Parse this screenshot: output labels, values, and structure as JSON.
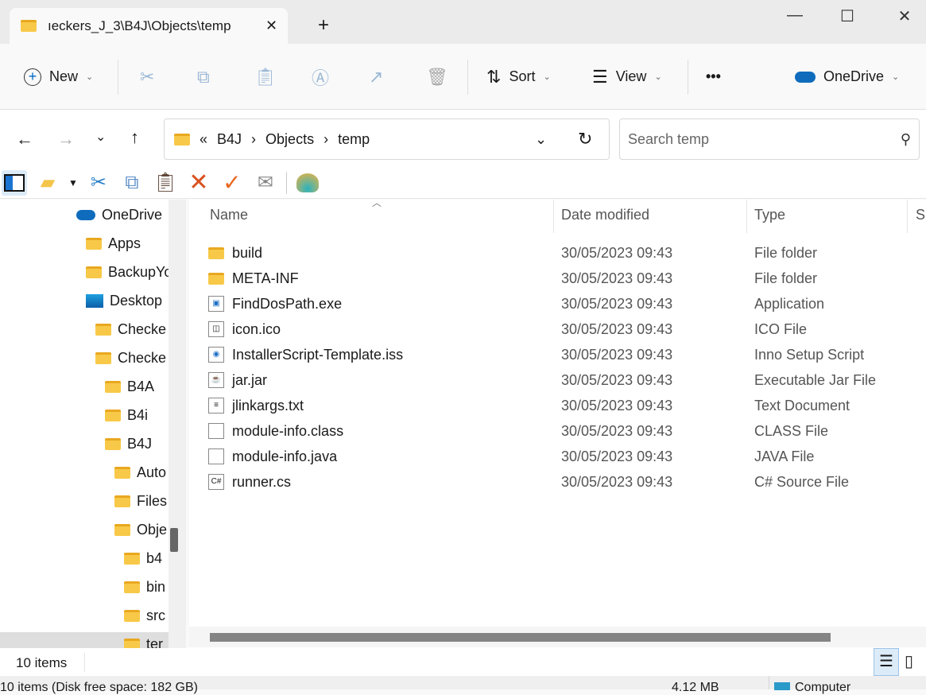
{
  "tab": {
    "title": "ıeckers_J_3\\B4J\\Objects\\temp",
    "close": "✕",
    "new_tab": "+"
  },
  "window": {
    "minimize": "—",
    "maximize": "☐",
    "close": "✕"
  },
  "toolbar": {
    "new_label": "New",
    "sort_label": "Sort",
    "view_label": "View",
    "more": "•••",
    "onedrive_label": "OneDrive"
  },
  "address": {
    "overflow": "«",
    "crumbs": [
      "B4J",
      "Objects",
      "temp"
    ],
    "sep": "›"
  },
  "search": {
    "placeholder": "Search temp"
  },
  "nav": [
    {
      "label": "OneDrive",
      "indent": 96,
      "icon": "cloud"
    },
    {
      "label": "Apps",
      "indent": 108,
      "icon": "folder"
    },
    {
      "label": "BackupYo",
      "indent": 108,
      "icon": "folder"
    },
    {
      "label": "Desktop",
      "indent": 108,
      "icon": "desktop"
    },
    {
      "label": "Checke",
      "indent": 120,
      "icon": "folder"
    },
    {
      "label": "Checke",
      "indent": 120,
      "icon": "folder"
    },
    {
      "label": "B4A",
      "indent": 132,
      "icon": "folder"
    },
    {
      "label": "B4i",
      "indent": 132,
      "icon": "folder"
    },
    {
      "label": "B4J",
      "indent": 132,
      "icon": "folder"
    },
    {
      "label": "Auto",
      "indent": 144,
      "icon": "folder"
    },
    {
      "label": "Files",
      "indent": 144,
      "icon": "folder"
    },
    {
      "label": "Obje",
      "indent": 144,
      "icon": "folder"
    },
    {
      "label": "b4",
      "indent": 156,
      "icon": "folder"
    },
    {
      "label": "bin",
      "indent": 156,
      "icon": "folder"
    },
    {
      "label": "src",
      "indent": 156,
      "icon": "folder"
    },
    {
      "label": "ter",
      "indent": 156,
      "icon": "folder",
      "selected": true
    }
  ],
  "columns": [
    "Name",
    "Date modified",
    "Type",
    "Si"
  ],
  "files": [
    {
      "name": "build",
      "date": "30/05/2023 09:43",
      "type": "File folder",
      "icon": "folder"
    },
    {
      "name": "META-INF",
      "date": "30/05/2023 09:43",
      "type": "File folder",
      "icon": "folder"
    },
    {
      "name": "FindDosPath.exe",
      "date": "30/05/2023 09:43",
      "type": "Application",
      "icon": "exe"
    },
    {
      "name": "icon.ico",
      "date": "30/05/2023 09:43",
      "type": "ICO File",
      "icon": "ico"
    },
    {
      "name": "InstallerScript-Template.iss",
      "date": "30/05/2023 09:43",
      "type": "Inno Setup Script",
      "icon": "iss"
    },
    {
      "name": "jar.jar",
      "date": "30/05/2023 09:43",
      "type": "Executable Jar File",
      "icon": "jar"
    },
    {
      "name": "jlinkargs.txt",
      "date": "30/05/2023 09:43",
      "type": "Text Document",
      "icon": "txt"
    },
    {
      "name": "module-info.class",
      "date": "30/05/2023 09:43",
      "type": "CLASS File",
      "icon": "file"
    },
    {
      "name": "module-info.java",
      "date": "30/05/2023 09:43",
      "type": "JAVA File",
      "icon": "file"
    },
    {
      "name": "runner.cs",
      "date": "30/05/2023 09:43",
      "type": "C# Source File",
      "icon": "cs"
    }
  ],
  "status": {
    "count": "10 items"
  },
  "bottom": {
    "left": "10 items (Disk free space: 182 GB)",
    "size": "4.12 MB",
    "location": "Computer"
  }
}
